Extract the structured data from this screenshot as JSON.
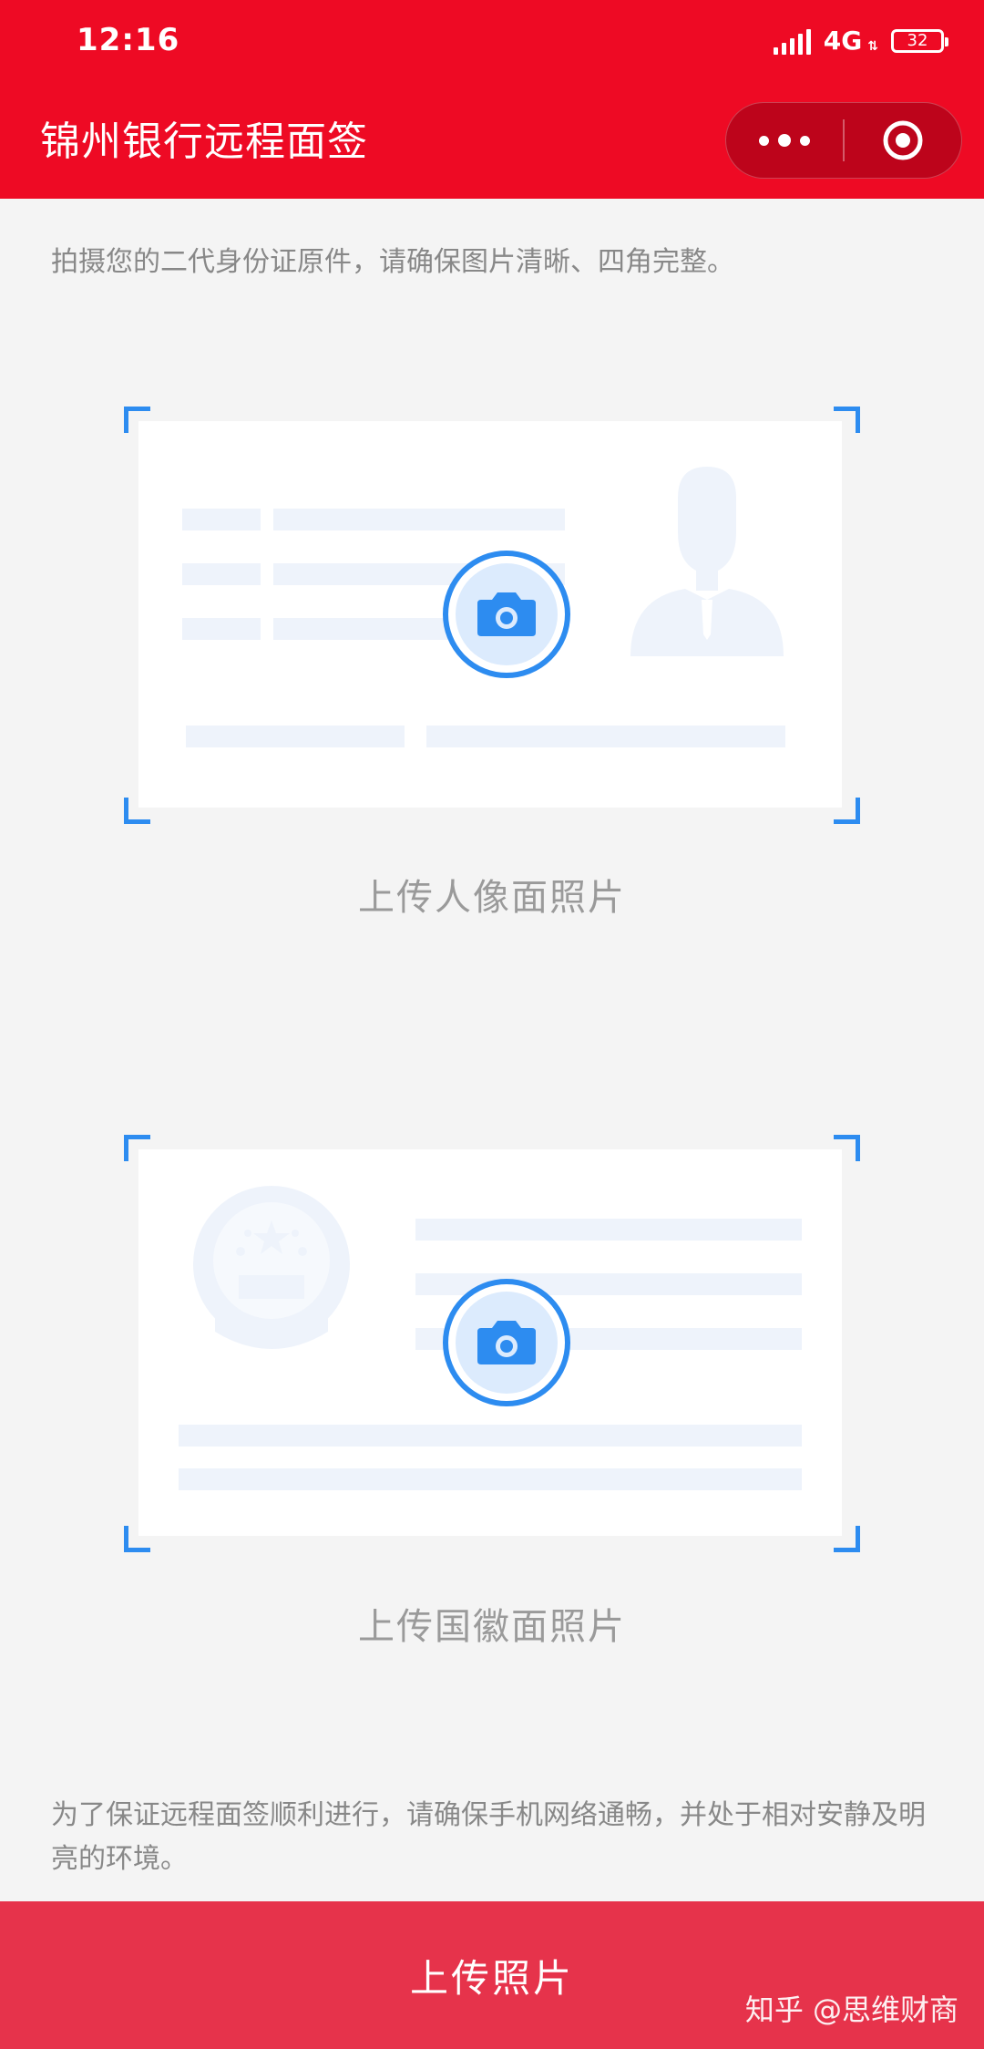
{
  "status_bar": {
    "time": "12:16",
    "network": "4G",
    "battery": "32"
  },
  "header": {
    "title": "锦州银行远程面签",
    "more_icon": "ellipsis-icon",
    "close_icon": "target-circle-icon",
    "color": "#ee0a24"
  },
  "instructions": {
    "top": "拍摄您的二代身份证原件，请确保图片清晰、四角完整。",
    "bottom": "为了保证远程面签顺利进行，请确保手机网络通畅，并处于相对安静及明亮的环境。"
  },
  "cards": [
    {
      "caption": "上传人像面照片",
      "icon": "camera-icon"
    },
    {
      "caption": "上传国徽面照片",
      "icon": "camera-icon"
    }
  ],
  "upload_button": {
    "label": "上传照片",
    "color": "#e6334b"
  },
  "watermark": "知乎 @思维财商",
  "accent_color": "#2d8cf0"
}
